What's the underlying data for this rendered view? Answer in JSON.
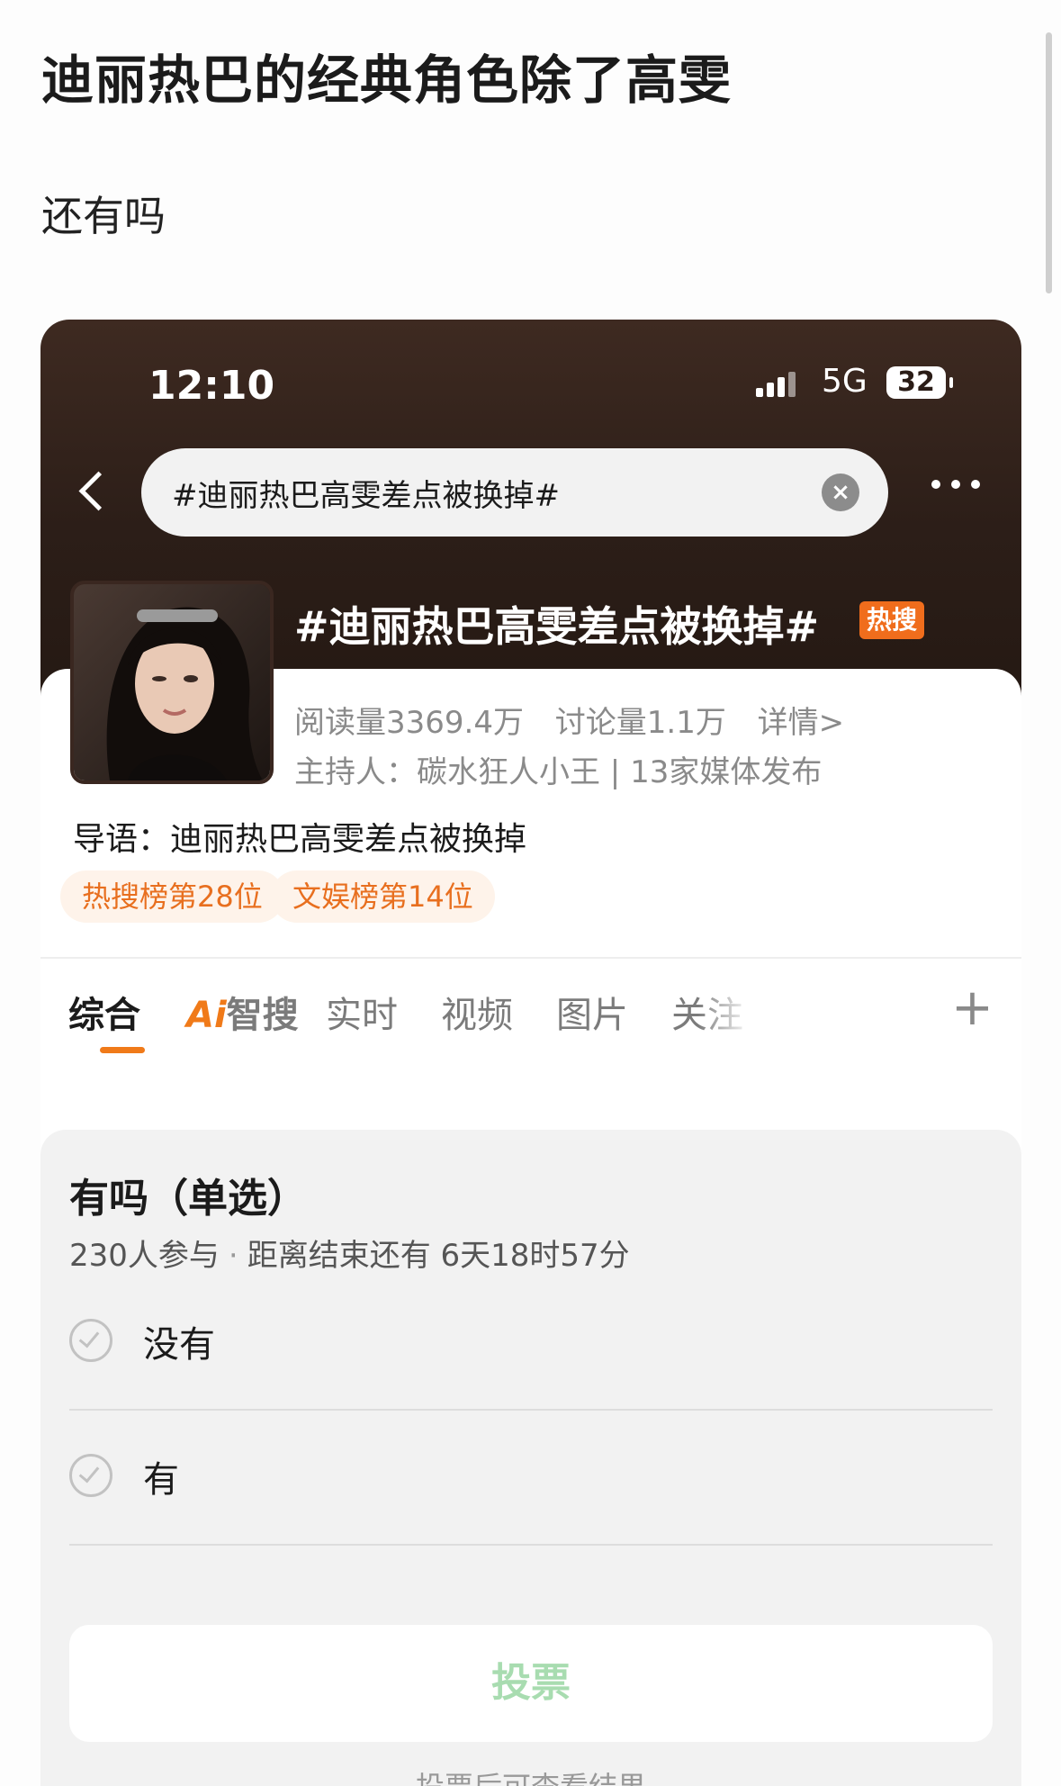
{
  "post": {
    "title": "迪丽热巴的经典角色除了高雯",
    "subtitle": "还有吗"
  },
  "status_bar": {
    "time": "12:10",
    "network": "5G",
    "battery": "32"
  },
  "search": {
    "query": "#迪丽热巴高雯差点被换掉#"
  },
  "topic": {
    "title": "#迪丽热巴高雯差点被换掉#",
    "badge": "热搜",
    "reads": "阅读量3369.4万",
    "discussions": "讨论量1.1万",
    "details": "详情>",
    "host": "主持人：碳水狂人小王 | 13家媒体发布",
    "guide": "导语：迪丽热巴高雯差点被换掉",
    "tags": [
      "热搜榜第28位",
      "文娱榜第14位"
    ]
  },
  "tabs": {
    "items": [
      "综合",
      "智搜",
      "实时",
      "视频",
      "图片",
      "关注"
    ],
    "ai_prefix": "Ai",
    "active_index": 0,
    "accent": "#f07a19"
  },
  "poll": {
    "title": "有吗（单选）",
    "participants": "230人参与",
    "separator": "·",
    "remaining": "距离结束还有 6天18时57分",
    "options": [
      "没有",
      "有"
    ],
    "vote_button": "投票",
    "after_vote_note": "投票后可查看结果"
  }
}
